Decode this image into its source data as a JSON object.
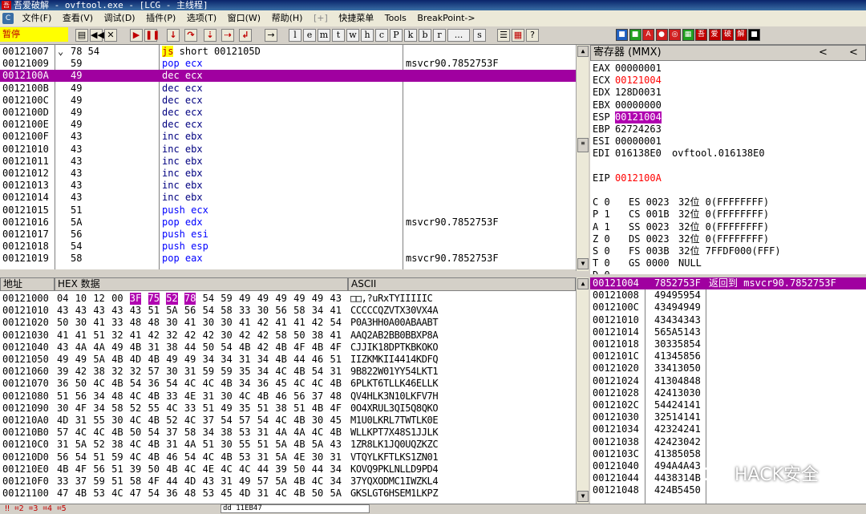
{
  "title": {
    "app_icon": "吾",
    "text": "吾爱破解 - ovftool.exe - [LCG - 主线程]"
  },
  "menu": {
    "sys_icon": "C",
    "items": [
      "文件(F)",
      "查看(V)",
      "调试(D)",
      "插件(P)",
      "选项(T)",
      "窗口(W)",
      "帮助(H)",
      "[+]",
      "快捷菜单",
      "Tools",
      "BreakPoint->"
    ]
  },
  "toolbar": {
    "status": "暂停",
    "letters": [
      "l",
      "e",
      "m",
      "t",
      "w",
      "h",
      "c",
      "P",
      "k",
      "b",
      "r",
      "...",
      "s"
    ],
    "color_buttons": [
      {
        "label": "■",
        "color": "#2060c0"
      },
      {
        "label": "■",
        "color": "#20a020"
      },
      {
        "label": "A",
        "color": "#d02020"
      },
      {
        "label": "●",
        "color": "#d02020"
      },
      {
        "label": "◎",
        "color": "#d02020"
      },
      {
        "label": "▦",
        "color": "#20a020"
      },
      {
        "label": "吾",
        "color": "#c00000"
      },
      {
        "label": "爱",
        "color": "#c00000"
      },
      {
        "label": "破",
        "color": "#c00000"
      },
      {
        "label": "解",
        "color": "#c00000"
      },
      {
        "label": "■",
        "color": "#000000"
      }
    ]
  },
  "disasm": {
    "rows": [
      {
        "addr": "00121007",
        "mark": "⌄",
        "hex": "78 54",
        "asm": "js short 0012105D",
        "cls": "js",
        "comment": ""
      },
      {
        "addr": "00121009",
        "mark": "",
        "hex": "59",
        "asm": "pop ecx",
        "cls": "blue",
        "comment": "msvcr90.7852753F"
      },
      {
        "addr": "0012100A",
        "mark": "",
        "hex": "49",
        "asm": "dec ecx",
        "cls": "sel",
        "comment": ""
      },
      {
        "addr": "0012100B",
        "mark": "",
        "hex": "49",
        "asm": "dec ecx",
        "cls": "dkblue",
        "comment": ""
      },
      {
        "addr": "0012100C",
        "mark": "",
        "hex": "49",
        "asm": "dec ecx",
        "cls": "dkblue",
        "comment": ""
      },
      {
        "addr": "0012100D",
        "mark": "",
        "hex": "49",
        "asm": "dec ecx",
        "cls": "dkblue",
        "comment": ""
      },
      {
        "addr": "0012100E",
        "mark": "",
        "hex": "49",
        "asm": "dec ecx",
        "cls": "dkblue",
        "comment": ""
      },
      {
        "addr": "0012100F",
        "mark": "",
        "hex": "43",
        "asm": "inc ebx",
        "cls": "dkblue",
        "comment": ""
      },
      {
        "addr": "00121010",
        "mark": "",
        "hex": "43",
        "asm": "inc ebx",
        "cls": "dkblue",
        "comment": ""
      },
      {
        "addr": "00121011",
        "mark": "",
        "hex": "43",
        "asm": "inc ebx",
        "cls": "dkblue",
        "comment": ""
      },
      {
        "addr": "00121012",
        "mark": "",
        "hex": "43",
        "asm": "inc ebx",
        "cls": "dkblue",
        "comment": ""
      },
      {
        "addr": "00121013",
        "mark": "",
        "hex": "43",
        "asm": "inc ebx",
        "cls": "dkblue",
        "comment": ""
      },
      {
        "addr": "00121014",
        "mark": "",
        "hex": "43",
        "asm": "inc ebx",
        "cls": "dkblue",
        "comment": ""
      },
      {
        "addr": "00121015",
        "mark": "",
        "hex": "51",
        "asm": "push ecx",
        "cls": "blue",
        "comment": ""
      },
      {
        "addr": "00121016",
        "mark": "",
        "hex": "5A",
        "asm": "pop edx",
        "cls": "blue",
        "comment": "msvcr90.7852753F"
      },
      {
        "addr": "00121017",
        "mark": "",
        "hex": "56",
        "asm": "push esi",
        "cls": "blue",
        "comment": ""
      },
      {
        "addr": "00121018",
        "mark": "",
        "hex": "54",
        "asm": "push esp",
        "cls": "blue",
        "comment": ""
      },
      {
        "addr": "00121019",
        "mark": "",
        "hex": "58",
        "asm": "pop eax",
        "cls": "blue",
        "comment": "msvcr90.7852753F"
      }
    ]
  },
  "registers": {
    "header": "寄存器 (MMX)",
    "nav_prev": "<",
    "nav_next": "<",
    "lines": [
      {
        "name": "EAX",
        "value": "00000001",
        "extra": "",
        "cls": ""
      },
      {
        "name": "ECX",
        "value": "00121004",
        "extra": "",
        "cls": "red"
      },
      {
        "name": "EDX",
        "value": "128D0031",
        "extra": "",
        "cls": ""
      },
      {
        "name": "EBX",
        "value": "00000000",
        "extra": "",
        "cls": ""
      },
      {
        "name": "ESP",
        "value": "00121004",
        "extra": "",
        "cls": "hl"
      },
      {
        "name": "EBP",
        "value": "62724263",
        "extra": "",
        "cls": ""
      },
      {
        "name": "ESI",
        "value": "00000001",
        "extra": "",
        "cls": ""
      },
      {
        "name": "EDI",
        "value": "016138E0",
        "extra": "ovftool.016138E0",
        "cls": ""
      },
      {
        "name": "",
        "value": "",
        "extra": "",
        "cls": ""
      },
      {
        "name": "EIP",
        "value": "0012100A",
        "extra": "",
        "cls": "red"
      },
      {
        "name": "",
        "value": "",
        "extra": "",
        "cls": ""
      },
      {
        "name": "C 0",
        "value": "ES 0023",
        "extra": "32位 0(FFFFFFFF)",
        "cls": ""
      },
      {
        "name": "P 1",
        "value": "CS 001B",
        "extra": "32位 0(FFFFFFFF)",
        "cls": ""
      },
      {
        "name": "A 1",
        "value": "SS 0023",
        "extra": "32位 0(FFFFFFFF)",
        "cls": ""
      },
      {
        "name": "Z 0",
        "value": "DS 0023",
        "extra": "32位 0(FFFFFFFF)",
        "cls": ""
      },
      {
        "name": "S 0",
        "value": "FS 003B",
        "extra": "32位 7FFDF000(FFF)",
        "cls": ""
      },
      {
        "name": "T 0",
        "value": "GS 0000",
        "extra": "NULL",
        "cls": ""
      },
      {
        "name": "D 0",
        "value": "",
        "extra": "",
        "cls": ""
      }
    ]
  },
  "dump": {
    "col_addr": "地址",
    "col_hex": "HEX 数据",
    "col_ascii": "ASCII",
    "rows": [
      {
        "addr": "00121000",
        "hex": [
          "04",
          "10",
          "12",
          "00",
          "3F",
          "75",
          "52",
          "78",
          "54",
          "59",
          "49",
          "49",
          "49",
          "49",
          "49",
          "43"
        ],
        "ascii": "□□,?uRxTYIIIIIC"
      },
      {
        "addr": "00121010",
        "hex": [
          "43",
          "43",
          "43",
          "43",
          "43",
          "51",
          "5A",
          "56",
          "54",
          "58",
          "33",
          "30",
          "56",
          "58",
          "34",
          "41"
        ],
        "ascii": "CCCCCQZVTX30VX4A"
      },
      {
        "addr": "00121020",
        "hex": [
          "50",
          "30",
          "41",
          "33",
          "48",
          "48",
          "30",
          "41",
          "30",
          "30",
          "41",
          "42",
          "41",
          "41",
          "42",
          "54"
        ],
        "ascii": "P0A3HH0A00ABAABT"
      },
      {
        "addr": "00121030",
        "hex": [
          "41",
          "41",
          "51",
          "32",
          "41",
          "42",
          "32",
          "42",
          "42",
          "30",
          "42",
          "42",
          "58",
          "50",
          "38",
          "41"
        ],
        "ascii": "AAQ2AB2BB0BBXP8A"
      },
      {
        "addr": "00121040",
        "hex": [
          "43",
          "4A",
          "4A",
          "49",
          "4B",
          "31",
          "38",
          "44",
          "50",
          "54",
          "4B",
          "42",
          "4B",
          "4F",
          "4B",
          "4F"
        ],
        "ascii": "CJJIK18DPTKBKOKO"
      },
      {
        "addr": "00121050",
        "hex": [
          "49",
          "49",
          "5A",
          "4B",
          "4D",
          "4B",
          "49",
          "49",
          "34",
          "34",
          "31",
          "34",
          "4B",
          "44",
          "46",
          "51"
        ],
        "ascii": "IIZKMKII4414KDFQ"
      },
      {
        "addr": "00121060",
        "hex": [
          "39",
          "42",
          "38",
          "32",
          "32",
          "57",
          "30",
          "31",
          "59",
          "59",
          "35",
          "34",
          "4C",
          "4B",
          "54",
          "31"
        ],
        "ascii": "9B822W01YY54LKT1"
      },
      {
        "addr": "00121070",
        "hex": [
          "36",
          "50",
          "4C",
          "4B",
          "54",
          "36",
          "54",
          "4C",
          "4C",
          "4B",
          "34",
          "36",
          "45",
          "4C",
          "4C",
          "4B"
        ],
        "ascii": "6PLKT6TLLK46ELLK"
      },
      {
        "addr": "00121080",
        "hex": [
          "51",
          "56",
          "34",
          "48",
          "4C",
          "4B",
          "33",
          "4E",
          "31",
          "30",
          "4C",
          "4B",
          "46",
          "56",
          "37",
          "48"
        ],
        "ascii": "QV4HLK3N10LKFV7H"
      },
      {
        "addr": "00121090",
        "hex": [
          "30",
          "4F",
          "34",
          "58",
          "52",
          "55",
          "4C",
          "33",
          "51",
          "49",
          "35",
          "51",
          "38",
          "51",
          "4B",
          "4F"
        ],
        "ascii": "0O4XRUL3QI5Q8QKO"
      },
      {
        "addr": "001210A0",
        "hex": [
          "4D",
          "31",
          "55",
          "30",
          "4C",
          "4B",
          "52",
          "4C",
          "37",
          "54",
          "57",
          "54",
          "4C",
          "4B",
          "30",
          "45"
        ],
        "ascii": "M1U0LKRL7TWTLK0E"
      },
      {
        "addr": "001210B0",
        "hex": [
          "57",
          "4C",
          "4C",
          "4B",
          "50",
          "54",
          "37",
          "58",
          "34",
          "38",
          "53",
          "31",
          "4A",
          "4A",
          "4C",
          "4B"
        ],
        "ascii": "WLLKPT7X48S1JJLK"
      },
      {
        "addr": "001210C0",
        "hex": [
          "31",
          "5A",
          "52",
          "38",
          "4C",
          "4B",
          "31",
          "4A",
          "51",
          "30",
          "55",
          "51",
          "5A",
          "4B",
          "5A",
          "43"
        ],
        "ascii": "1ZR8LK1JQ0UQZKZC"
      },
      {
        "addr": "001210D0",
        "hex": [
          "56",
          "54",
          "51",
          "59",
          "4C",
          "4B",
          "46",
          "54",
          "4C",
          "4B",
          "53",
          "31",
          "5A",
          "4E",
          "30",
          "31"
        ],
        "ascii": "VTQYLKFTLKS1ZN01"
      },
      {
        "addr": "001210E0",
        "hex": [
          "4B",
          "4F",
          "56",
          "51",
          "39",
          "50",
          "4B",
          "4C",
          "4E",
          "4C",
          "4C",
          "44",
          "39",
          "50",
          "44",
          "34"
        ],
        "ascii": "KOVQ9PKLNLLD9PD4"
      },
      {
        "addr": "001210F0",
        "hex": [
          "33",
          "37",
          "59",
          "51",
          "58",
          "4F",
          "44",
          "4D",
          "43",
          "31",
          "49",
          "57",
          "5A",
          "4B",
          "4C",
          "34"
        ],
        "ascii": "37YQXODMC1IWZKL4"
      },
      {
        "addr": "00121100",
        "hex": [
          "47",
          "4B",
          "53",
          "4C",
          "47",
          "54",
          "36",
          "48",
          "53",
          "45",
          "4D",
          "31",
          "4C",
          "4B",
          "50",
          "5A"
        ],
        "ascii": "GKSLGT6HSEM1LKPZ"
      }
    ]
  },
  "stack": {
    "top": {
      "addr": "00121004",
      "value": "7852753F",
      "comment": "返回到 msvcr90.7852753F"
    },
    "rows": [
      {
        "addr": "00121008",
        "value": "49495954"
      },
      {
        "addr": "0012100C",
        "value": "43494949"
      },
      {
        "addr": "00121010",
        "value": "43434343"
      },
      {
        "addr": "00121014",
        "value": "565A5143"
      },
      {
        "addr": "00121018",
        "value": "30335854"
      },
      {
        "addr": "0012101C",
        "value": "41345856"
      },
      {
        "addr": "00121020",
        "value": "33413050"
      },
      {
        "addr": "00121024",
        "value": "41304848"
      },
      {
        "addr": "00121028",
        "value": "42413030"
      },
      {
        "addr": "0012102C",
        "value": "54424141"
      },
      {
        "addr": "00121030",
        "value": "32514141"
      },
      {
        "addr": "00121034",
        "value": "42324241"
      },
      {
        "addr": "00121038",
        "value": "42423042"
      },
      {
        "addr": "0012103C",
        "value": "41385058"
      },
      {
        "addr": "00121040",
        "value": "494A4A43"
      },
      {
        "addr": "00121044",
        "value": "4438314B"
      },
      {
        "addr": "00121048",
        "value": "424B5450"
      }
    ]
  },
  "command": {
    "value": "dd 11EB47"
  },
  "watermark": {
    "text": "HACK安全"
  }
}
